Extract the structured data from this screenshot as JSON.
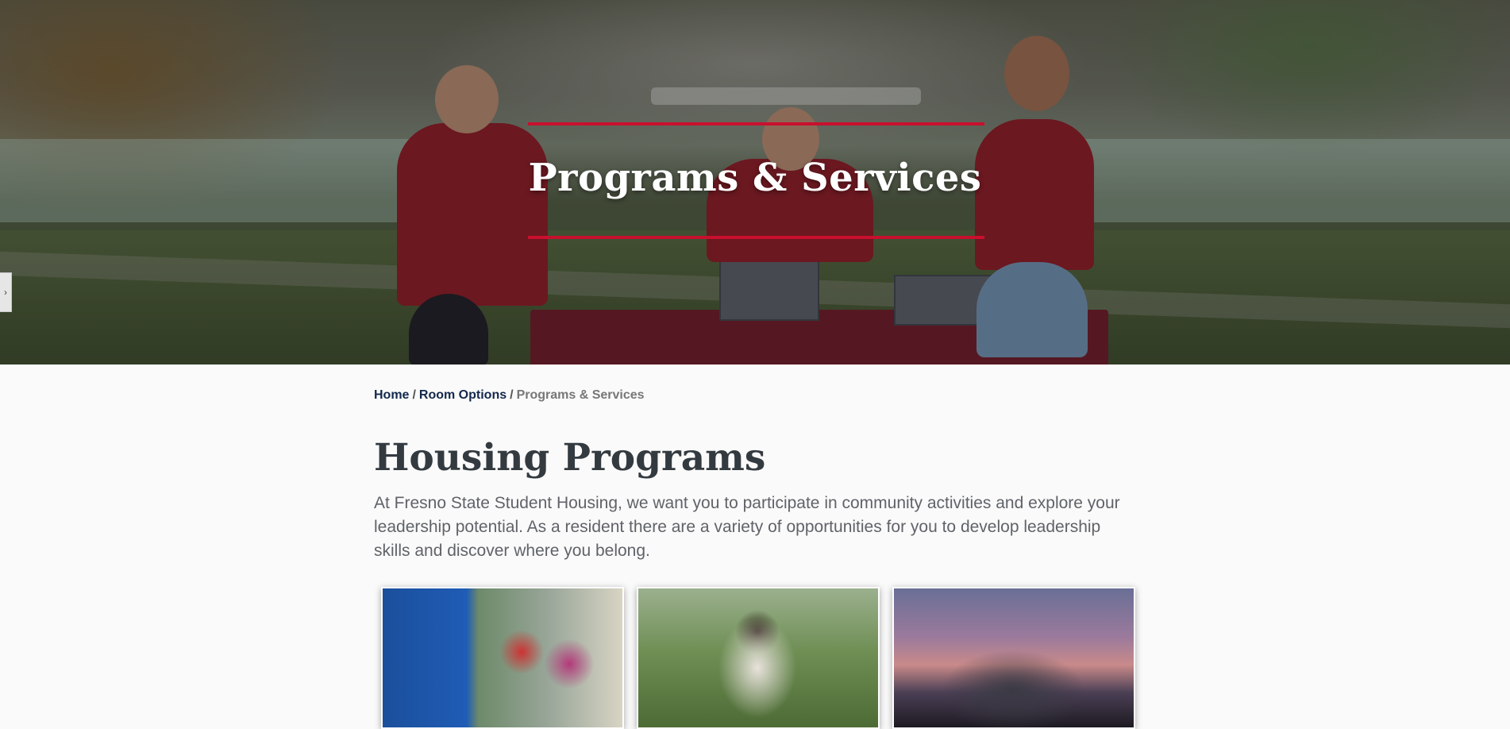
{
  "hero": {
    "title": "Programs & Services",
    "accent_color": "#c8102e"
  },
  "side_toggle": {
    "icon": "chevron-right-icon",
    "glyph": "›"
  },
  "breadcrumb": {
    "home": "Home",
    "room_options": "Room Options",
    "current": "Programs & Services",
    "separator": "/"
  },
  "main": {
    "heading": "Housing Programs",
    "intro": "At Fresno State Student Housing, we want you to participate in community activities and explore your leadership potential. As a resident there are a variety of opportunities for you to develop leadership skills and discover where you belong."
  },
  "cards": [
    {
      "name": "program-card-1"
    },
    {
      "name": "program-card-2"
    },
    {
      "name": "program-card-3"
    }
  ]
}
